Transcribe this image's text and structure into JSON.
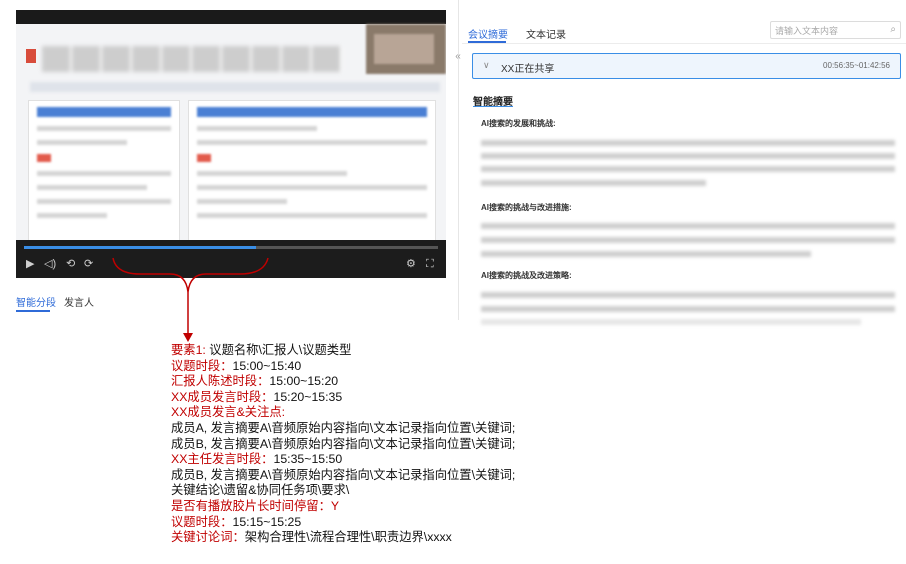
{
  "left_tabs": [
    "智能分段",
    "发言人"
  ],
  "right_tabs": [
    "会议摘要",
    "文本记录"
  ],
  "search": {
    "placeholder": "请输入文本内容"
  },
  "sharing": {
    "label": "XX正在共享",
    "time_range": "00:56:35~01:42:56"
  },
  "summary": {
    "title": "智能摘要",
    "sections": [
      "AI搜索的发展和挑战:",
      "AI搜索的挑战与改进措施:",
      "AI搜索的挑战及改进策略:"
    ]
  },
  "video": {
    "progress": 0.56
  },
  "annotation": [
    [
      {
        "c": "r",
        "t": "要素1: "
      },
      {
        "c": "k",
        "t": "议题名称\\汇报人\\议题类型"
      }
    ],
    [
      {
        "c": "r",
        "t": "议题时段："
      },
      {
        "c": "k",
        "t": "15:00~15:40"
      }
    ],
    [
      {
        "c": "r",
        "t": "汇报人陈述时段："
      },
      {
        "c": "k",
        "t": "15:00~15:20"
      }
    ],
    [
      {
        "c": "r",
        "t": "XX成员发言时段："
      },
      {
        "c": "k",
        "t": "15:20~15:35"
      }
    ],
    [
      {
        "c": "r",
        "t": "XX成员发言&关注点:"
      }
    ],
    [
      {
        "c": "k",
        "t": "成员A, 发言摘要A\\音频原始内容指向\\文本记录指向位置\\关键词;"
      }
    ],
    [
      {
        "c": "k",
        "t": "成员B, 发言摘要A\\音频原始内容指向\\文本记录指向位置\\关键词;"
      }
    ],
    [
      {
        "c": "r",
        "t": "XX主任发言时段："
      },
      {
        "c": "k",
        "t": "15:35~15:50"
      }
    ],
    [
      {
        "c": "k",
        "t": "成员B, 发言摘要A\\音频原始内容指向\\文本记录指向位置\\关键词;"
      }
    ],
    [
      {
        "c": "k",
        "t": "关键结论\\遗留&协同任务项\\要求\\"
      }
    ],
    [
      {
        "c": "r",
        "t": "是否有播放胶片长时间停留：Y"
      }
    ],
    [
      {
        "c": "r",
        "t": "议题时段："
      },
      {
        "c": "k",
        "t": "15:15~15:25"
      }
    ],
    [
      {
        "c": "r",
        "t": "关键讨论词："
      },
      {
        "c": "k",
        "t": "架构合理性\\流程合理性\\职责边界\\xxxx"
      }
    ]
  ]
}
